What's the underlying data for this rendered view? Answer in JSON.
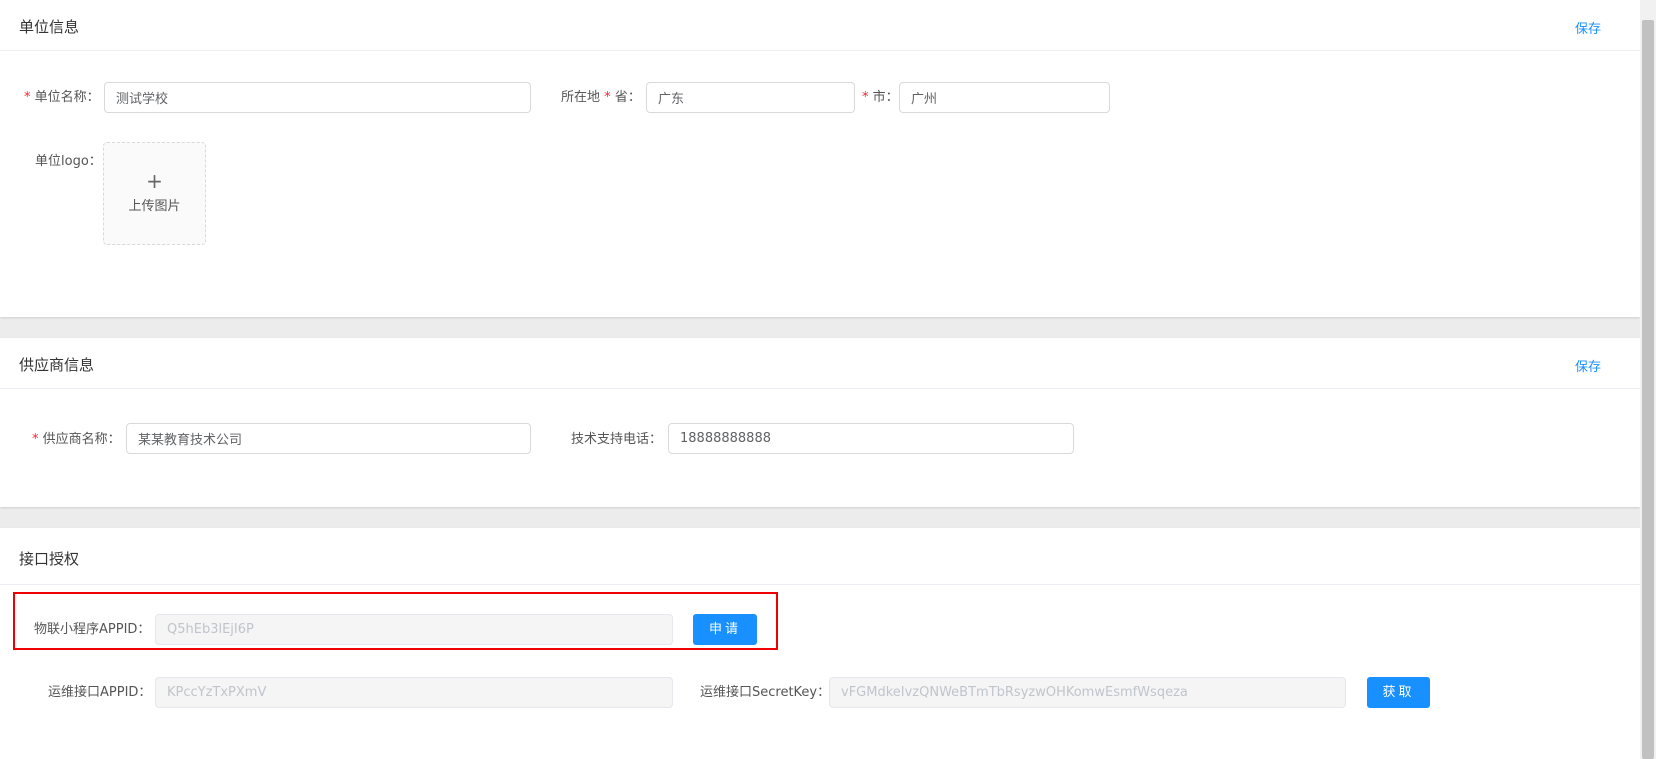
{
  "unit_section": {
    "title": "单位信息",
    "save_label": "保存",
    "name_label": "单位名称",
    "name_value": "测试学校",
    "location_label": "所在地",
    "province_label": "省",
    "province_value": "广东",
    "city_label": "市",
    "city_value": "广州",
    "logo_label": "单位logo",
    "upload_plus": "+",
    "upload_text": "上传图片"
  },
  "supplier_section": {
    "title": "供应商信息",
    "save_label": "保存",
    "name_label": "供应商名称",
    "name_value": "某某教育技术公司",
    "phone_label": "技术支持电话",
    "phone_value": "18888888888"
  },
  "api_section": {
    "title": "接口授权",
    "miniapp_appid_label": "物联小程序APPID",
    "miniapp_appid_value": "Q5hEb3lEjI6P",
    "apply_button": "申请",
    "ops_appid_label": "运维接口APPID",
    "ops_appid_value": "KPccYzTxPXmV",
    "ops_secret_label": "运维接口SecretKey",
    "ops_secret_value": "vFGMdkeIvzQNWeBTmTbRsyzwOHKomwEsmfWsqeza",
    "fetch_button": "获取"
  },
  "common": {
    "required_mark": "*",
    "colon": "："
  },
  "colors": {
    "accent": "#1890ff",
    "highlight": "#ee0000",
    "required": "#f5222d"
  }
}
